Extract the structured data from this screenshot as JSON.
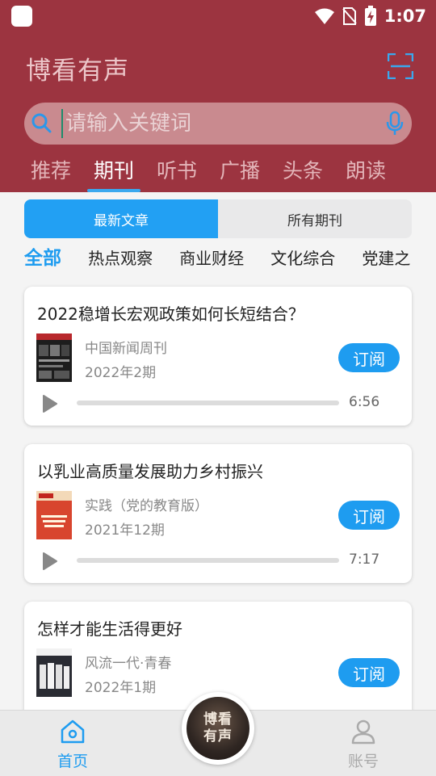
{
  "status": {
    "time": "1:07"
  },
  "app_title": "博看有声",
  "search": {
    "placeholder": "请输入关键词"
  },
  "categories": [
    "推荐",
    "期刊",
    "听书",
    "广播",
    "头条",
    "朗读"
  ],
  "active_category": "期刊",
  "segments": {
    "latest": "最新文章",
    "all": "所有期刊"
  },
  "tags": [
    "全部",
    "热点观察",
    "商业财经",
    "文化综合",
    "党建之"
  ],
  "cards": [
    {
      "title": "2022稳增长宏观政策如何长短结合？",
      "magazine": "中国新闻周刊",
      "issue": "2022年2期",
      "subscribe": "订阅",
      "duration": "6:56"
    },
    {
      "title": "以乳业高质量发展助力乡村振兴",
      "magazine": "实践（党的教育版）",
      "issue": "2021年12期",
      "subscribe": "订阅",
      "duration": "7:17"
    },
    {
      "title": "怎样才能生活得更好",
      "magazine": "风流一代·青春",
      "issue": "2022年1期",
      "subscribe": "订阅",
      "duration": ""
    }
  ],
  "bottom_nav": {
    "home": "首页",
    "center_logo": "博看有声",
    "account": "账号"
  },
  "colors": {
    "header": "#9c3440",
    "accent": "#1e9cf0"
  }
}
